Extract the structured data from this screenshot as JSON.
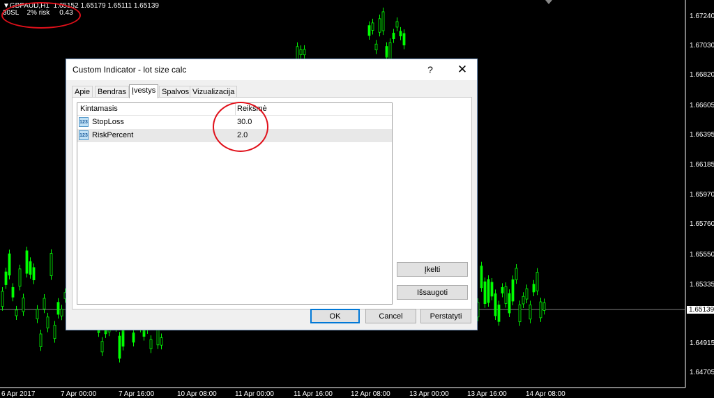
{
  "chart": {
    "header": {
      "symbol_line": "GBPAUD,H1",
      "prices": "1.65152 1.65179 1.65111 1.65139"
    },
    "indicator_line": {
      "sl": "30SL",
      "risk": "2% risk",
      "value": "0.43"
    },
    "price_labels": [
      "1.67240",
      "1.67030",
      "1.66820",
      "1.66605",
      "1.66395",
      "1.66185",
      "1.65970",
      "1.65760",
      "1.65550",
      "1.65335",
      "1.65139",
      "1.64915",
      "1.64705"
    ],
    "current_price": "1.65139",
    "time_labels": [
      "6 Apr 2017",
      "7 Apr 00:00",
      "7 Apr 16:00",
      "10 Apr 08:00",
      "11 Apr 00:00",
      "11 Apr 16:00",
      "12 Apr 08:00",
      "13 Apr 00:00",
      "13 Apr 16:00",
      "14 Apr 08:00"
    ],
    "colors": {
      "background": "#000000",
      "candle_up": "#00ff00",
      "grid": "#808080",
      "annotation": "#e0101a"
    }
  },
  "dialog": {
    "title": "Custom Indicator - lot size calc",
    "help_label": "?",
    "close_label": "✕",
    "tabs": [
      {
        "label": "Apie"
      },
      {
        "label": "Bendras"
      },
      {
        "label": "Įvestys"
      },
      {
        "label": "Spalvos"
      },
      {
        "label": "Vizualizacija"
      }
    ],
    "active_tab": "Įvestys",
    "grid": {
      "col_variable": "Kintamasis",
      "col_value": "Reikšmė",
      "rows": [
        {
          "icon": "variable-icon",
          "icon_text": "123",
          "name": "StopLoss",
          "value": "30.0"
        },
        {
          "icon": "variable-icon",
          "icon_text": "123",
          "name": "RiskPercent",
          "value": "2.0"
        }
      ]
    },
    "buttons": {
      "load": "Įkelti",
      "save": "Išsaugoti",
      "ok": "OK",
      "cancel": "Cancel",
      "reset": "Perstatyti"
    }
  }
}
